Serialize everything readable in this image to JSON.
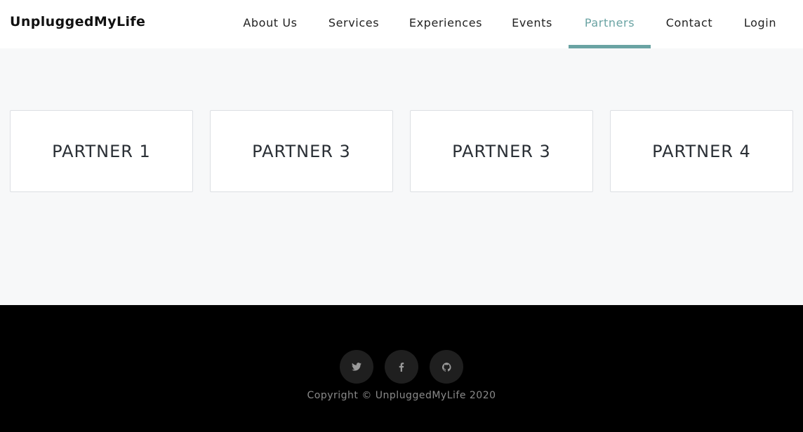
{
  "header": {
    "brand": "UnpluggedMyLife",
    "nav": [
      {
        "label": "About Us",
        "active": false
      },
      {
        "label": "Services",
        "active": false
      },
      {
        "label": "Experiences",
        "active": false
      },
      {
        "label": "Events",
        "active": false
      },
      {
        "label": "Partners",
        "active": true
      },
      {
        "label": "Contact",
        "active": false
      },
      {
        "label": "Login",
        "active": false
      }
    ]
  },
  "partners": [
    {
      "name": "PARTNER 1"
    },
    {
      "name": "PARTNER 3"
    },
    {
      "name": "PARTNER 3"
    },
    {
      "name": "PARTNER 4"
    }
  ],
  "footer": {
    "social": [
      {
        "icon": "twitter-icon"
      },
      {
        "icon": "facebook-icon"
      },
      {
        "icon": "github-icon"
      }
    ],
    "copyright": "Copyright © UnpluggedMyLife 2020"
  },
  "colors": {
    "accent": "#6aa3a3",
    "footer_bg": "#000000",
    "page_bg": "#f7f8f9"
  }
}
